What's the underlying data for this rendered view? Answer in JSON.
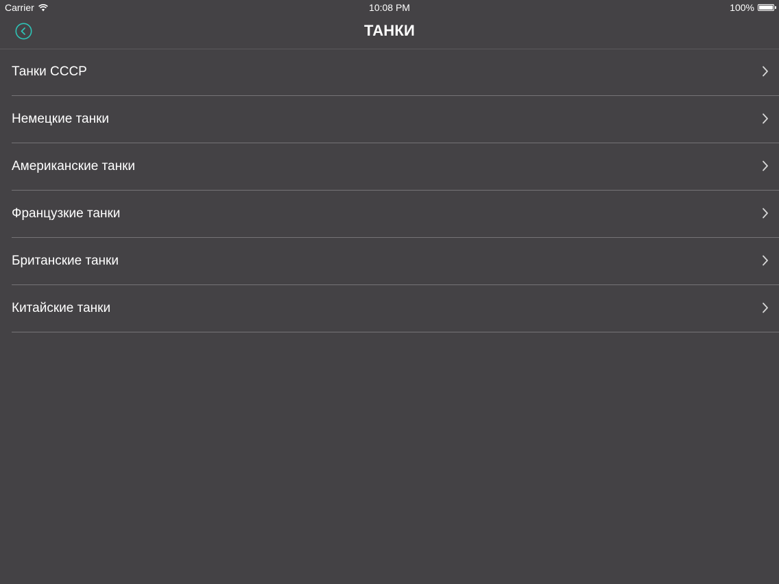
{
  "status_bar": {
    "carrier": "Carrier",
    "time": "10:08 PM",
    "battery": "100%",
    "battery_level": 1.0
  },
  "nav": {
    "title": "ТАНКИ",
    "back_icon": "back-circle-icon",
    "accent_color": "#2ec4b6"
  },
  "list": {
    "items": [
      {
        "label": "Танки СССР"
      },
      {
        "label": "Немецкие танки"
      },
      {
        "label": "Американские танки"
      },
      {
        "label": "Французкие танки"
      },
      {
        "label": "Британские танки"
      },
      {
        "label": "Китайские танки"
      }
    ],
    "chevron_icon": "chevron-right-icon"
  },
  "colors": {
    "background": "#444245",
    "separator": "#767477",
    "text": "#ffffff"
  }
}
